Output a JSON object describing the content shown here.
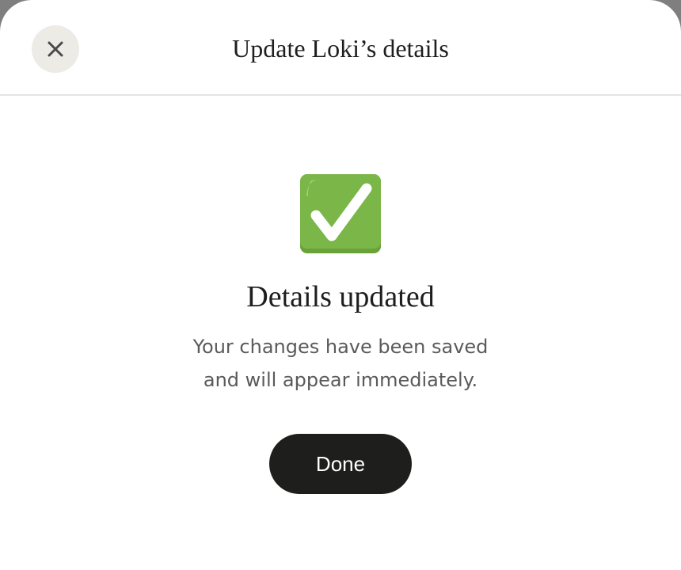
{
  "dialog": {
    "title": "Update Loki’s details",
    "close_icon": "close-icon"
  },
  "success": {
    "icon": "check-mark-button-icon",
    "heading": "Details updated",
    "message_line1": "Your changes have been saved",
    "message_line2": "and will appear immediately.",
    "done_label": "Done"
  },
  "colors": {
    "close_button_bg": "#ecebe6",
    "check_green": "#7ab648",
    "done_button_bg": "#1e1e1c",
    "message_text": "#5a5a5a"
  }
}
